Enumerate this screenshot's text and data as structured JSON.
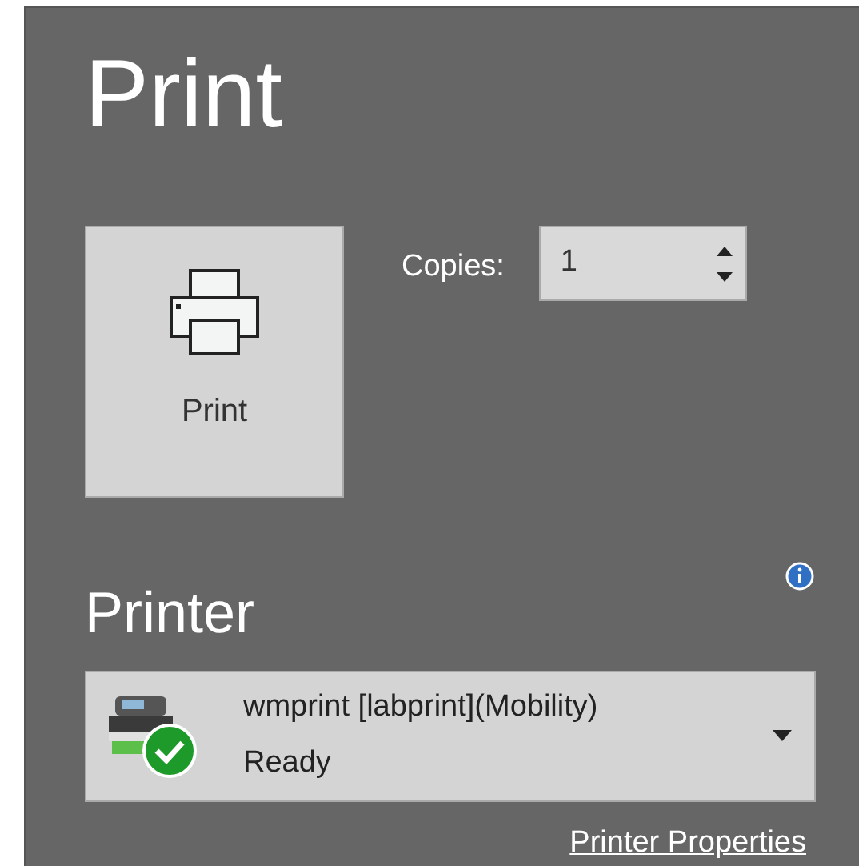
{
  "title": "Print",
  "print_button": {
    "label": "Print"
  },
  "copies": {
    "label": "Copies:",
    "value": "1"
  },
  "printer_section": {
    "heading": "Printer",
    "printer": {
      "name": "wmprint [labprint](Mobility)",
      "status": "Ready"
    },
    "properties_link": "Printer Properties"
  }
}
